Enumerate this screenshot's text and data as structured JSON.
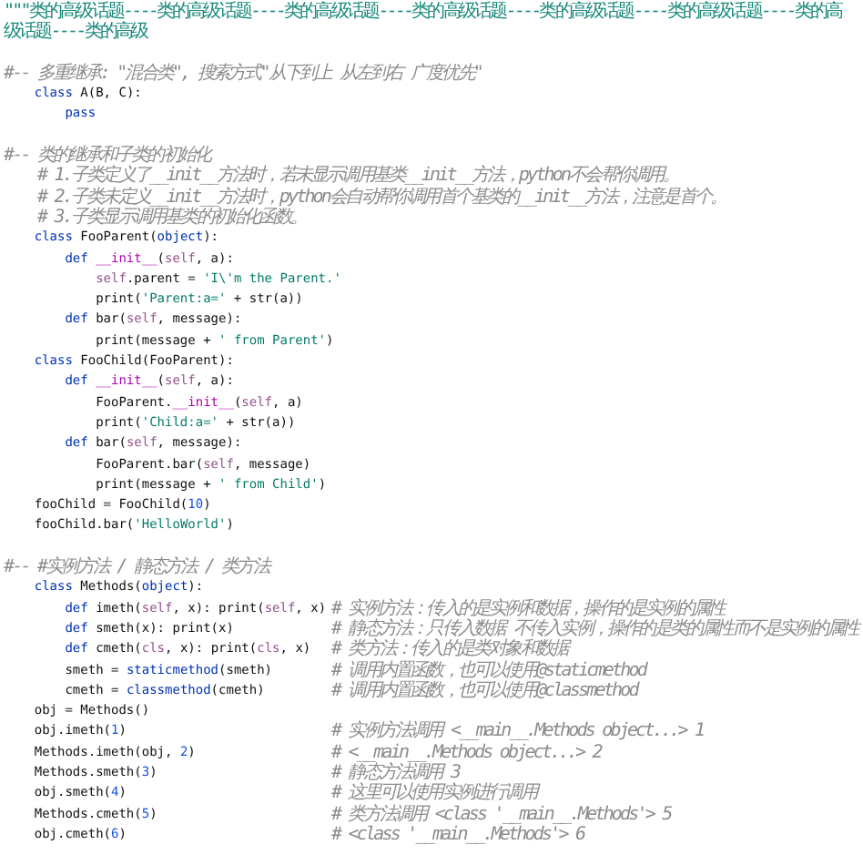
{
  "lines": [
    {
      "kind": "docstring",
      "text": "\"\"\"类的高级话题----类的高级话题----类的高级话题----类的高级话题----类的高级话题----类的高级话题----类的高级话题----类的高级"
    },
    {
      "kind": "blank"
    },
    {
      "kind": "comment",
      "text": "#-- 多重继承: \"混合类\", 搜索方式\"从下到上 从左到右 广度优先\""
    },
    {
      "kind": "code",
      "tokens": [
        {
          "kind": "keyword",
          "text": "    class"
        },
        {
          "kind": "plain",
          "text": " A(B, C):"
        }
      ]
    },
    {
      "kind": "code",
      "tokens": [
        {
          "kind": "keyword",
          "text": "        pass"
        }
      ]
    },
    {
      "kind": "blank"
    },
    {
      "kind": "comment",
      "text": "#-- 类的继承和子类的初始化"
    },
    {
      "kind": "comment",
      "text": "    # 1.子类定义了__init__方法时，若未显示调用基类__init__方法，python不会帮你调用。"
    },
    {
      "kind": "comment",
      "text": "    # 2.子类未定义__init__方法时，python会自动帮你调用首个基类的__init__方法，注意是首个。"
    },
    {
      "kind": "comment",
      "text": "    # 3.子类显示调用基类的初始化函数。"
    },
    {
      "kind": "code",
      "tokens": [
        {
          "kind": "keyword",
          "text": "    class"
        },
        {
          "kind": "plain",
          "text": " FooParent("
        },
        {
          "kind": "keyword",
          "text": "object"
        },
        {
          "kind": "plain",
          "text": "):"
        }
      ]
    },
    {
      "kind": "code",
      "tokens": [
        {
          "kind": "keyword",
          "text": "        def"
        },
        {
          "kind": "magic",
          "text": " __init__"
        },
        {
          "kind": "plain",
          "text": "("
        },
        {
          "kind": "self",
          "text": "self"
        },
        {
          "kind": "plain",
          "text": ", a):"
        }
      ]
    },
    {
      "kind": "code",
      "tokens": [
        {
          "kind": "self",
          "text": "            self"
        },
        {
          "kind": "plain",
          "text": ".parent = "
        },
        {
          "kind": "string",
          "text": "'I\\'m the Parent.'"
        }
      ]
    },
    {
      "kind": "code",
      "tokens": [
        {
          "kind": "plain",
          "text": "            print("
        },
        {
          "kind": "string",
          "text": "'Parent:a='"
        },
        {
          "kind": "plain",
          "text": " + str(a))"
        }
      ]
    },
    {
      "kind": "code",
      "tokens": [
        {
          "kind": "keyword",
          "text": "        def"
        },
        {
          "kind": "plain",
          "text": " bar("
        },
        {
          "kind": "self",
          "text": "self"
        },
        {
          "kind": "plain",
          "text": ", message):"
        }
      ]
    },
    {
      "kind": "code",
      "tokens": [
        {
          "kind": "plain",
          "text": "            print(message + "
        },
        {
          "kind": "string",
          "text": "' from Parent'"
        },
        {
          "kind": "plain",
          "text": ")"
        }
      ]
    },
    {
      "kind": "code",
      "tokens": [
        {
          "kind": "keyword",
          "text": "    class"
        },
        {
          "kind": "plain",
          "text": " FooChild(FooParent):"
        }
      ]
    },
    {
      "kind": "code",
      "tokens": [
        {
          "kind": "keyword",
          "text": "        def"
        },
        {
          "kind": "magic",
          "text": " __init__"
        },
        {
          "kind": "plain",
          "text": "("
        },
        {
          "kind": "self",
          "text": "self"
        },
        {
          "kind": "plain",
          "text": ", a):"
        }
      ]
    },
    {
      "kind": "code",
      "tokens": [
        {
          "kind": "plain",
          "text": "            FooParent."
        },
        {
          "kind": "magic",
          "text": "__init__"
        },
        {
          "kind": "plain",
          "text": "("
        },
        {
          "kind": "self",
          "text": "self"
        },
        {
          "kind": "plain",
          "text": ", a)"
        }
      ]
    },
    {
      "kind": "code",
      "tokens": [
        {
          "kind": "plain",
          "text": "            print("
        },
        {
          "kind": "string",
          "text": "'Child:a='"
        },
        {
          "kind": "plain",
          "text": " + str(a))"
        }
      ]
    },
    {
      "kind": "code",
      "tokens": [
        {
          "kind": "keyword",
          "text": "        def"
        },
        {
          "kind": "plain",
          "text": " bar("
        },
        {
          "kind": "self",
          "text": "self"
        },
        {
          "kind": "plain",
          "text": ", message):"
        }
      ]
    },
    {
      "kind": "code",
      "tokens": [
        {
          "kind": "plain",
          "text": "            FooParent.bar("
        },
        {
          "kind": "self",
          "text": "self"
        },
        {
          "kind": "plain",
          "text": ", message)"
        }
      ]
    },
    {
      "kind": "code",
      "tokens": [
        {
          "kind": "plain",
          "text": "            print(message + "
        },
        {
          "kind": "string",
          "text": "' from Child'"
        },
        {
          "kind": "plain",
          "text": ")"
        }
      ]
    },
    {
      "kind": "code",
      "tokens": [
        {
          "kind": "plain",
          "text": "    fooChild = FooChild("
        },
        {
          "kind": "number",
          "text": "10"
        },
        {
          "kind": "plain",
          "text": ")"
        }
      ]
    },
    {
      "kind": "code",
      "tokens": [
        {
          "kind": "plain",
          "text": "    fooChild.bar("
        },
        {
          "kind": "string",
          "text": "'HelloWorld'"
        },
        {
          "kind": "plain",
          "text": ")"
        }
      ]
    },
    {
      "kind": "blank"
    },
    {
      "kind": "comment",
      "text": "#-- #实例方法 / 静态方法 / 类方法"
    },
    {
      "kind": "code",
      "tokens": [
        {
          "kind": "keyword",
          "text": "    class"
        },
        {
          "kind": "plain",
          "text": " Methods("
        },
        {
          "kind": "keyword",
          "text": "object"
        },
        {
          "kind": "plain",
          "text": "):"
        }
      ]
    },
    {
      "kind": "code",
      "tokens": [
        {
          "kind": "keyword",
          "text": "        def"
        },
        {
          "kind": "plain",
          "text": " imeth("
        },
        {
          "kind": "self",
          "text": "self"
        },
        {
          "kind": "plain",
          "text": ", x): print("
        },
        {
          "kind": "self",
          "text": "self"
        },
        {
          "kind": "plain",
          "text": ", x)"
        }
      ],
      "comment": "# 实例方法：传入的是实例和数据，操作的是实例的属性"
    },
    {
      "kind": "code",
      "tokens": [
        {
          "kind": "keyword",
          "text": "        def"
        },
        {
          "kind": "plain",
          "text": " smeth(x): print(x)"
        }
      ],
      "comment": "# 静态方法：只传入数据 不传入实例，操作的是类的属性而不是实例的属性"
    },
    {
      "kind": "code",
      "tokens": [
        {
          "kind": "keyword",
          "text": "        def"
        },
        {
          "kind": "plain",
          "text": " cmeth("
        },
        {
          "kind": "self",
          "text": "cls"
        },
        {
          "kind": "plain",
          "text": ", x): print("
        },
        {
          "kind": "self",
          "text": "cls"
        },
        {
          "kind": "plain",
          "text": ", x)"
        }
      ],
      "comment": "# 类方法：传入的是类对象和数据"
    },
    {
      "kind": "code",
      "tokens": [
        {
          "kind": "plain",
          "text": "        smeth = "
        },
        {
          "kind": "keyword",
          "text": "staticmethod"
        },
        {
          "kind": "plain",
          "text": "(smeth)"
        }
      ],
      "comment": "# 调用内置函数，也可以使用@staticmethod"
    },
    {
      "kind": "code",
      "tokens": [
        {
          "kind": "plain",
          "text": "        cmeth = "
        },
        {
          "kind": "keyword",
          "text": "classmethod"
        },
        {
          "kind": "plain",
          "text": "(cmeth)"
        }
      ],
      "comment": "# 调用内置函数，也可以使用@classmethod"
    },
    {
      "kind": "code",
      "tokens": [
        {
          "kind": "plain",
          "text": "    obj = Methods()"
        }
      ]
    },
    {
      "kind": "code",
      "tokens": [
        {
          "kind": "plain",
          "text": "    obj.imeth("
        },
        {
          "kind": "number",
          "text": "1"
        },
        {
          "kind": "plain",
          "text": ")"
        }
      ],
      "comment": "# 实例方法调用 <__main__.Methods object...> 1"
    },
    {
      "kind": "code",
      "tokens": [
        {
          "kind": "plain",
          "text": "    Methods.imeth(obj, "
        },
        {
          "kind": "number",
          "text": "2"
        },
        {
          "kind": "plain",
          "text": ")"
        }
      ],
      "comment": "# <__main__.Methods object...> 2"
    },
    {
      "kind": "code",
      "tokens": [
        {
          "kind": "plain",
          "text": "    Methods.smeth("
        },
        {
          "kind": "number",
          "text": "3"
        },
        {
          "kind": "plain",
          "text": ")"
        }
      ],
      "comment": "# 静态方法调用 3"
    },
    {
      "kind": "code",
      "tokens": [
        {
          "kind": "plain",
          "text": "    obj.smeth("
        },
        {
          "kind": "number",
          "text": "4"
        },
        {
          "kind": "plain",
          "text": ")"
        }
      ],
      "comment": "# 这里可以使用实例进行调用"
    },
    {
      "kind": "code",
      "tokens": [
        {
          "kind": "plain",
          "text": "    Methods.cmeth("
        },
        {
          "kind": "number",
          "text": "5"
        },
        {
          "kind": "plain",
          "text": ")"
        }
      ],
      "comment": "# 类方法调用 <class '__main__.Methods'> 5"
    },
    {
      "kind": "code",
      "tokens": [
        {
          "kind": "plain",
          "text": "    obj.cmeth("
        },
        {
          "kind": "number",
          "text": "6"
        },
        {
          "kind": "plain",
          "text": ")"
        }
      ],
      "comment": "# <class '__main__.Methods'> 6"
    }
  ]
}
